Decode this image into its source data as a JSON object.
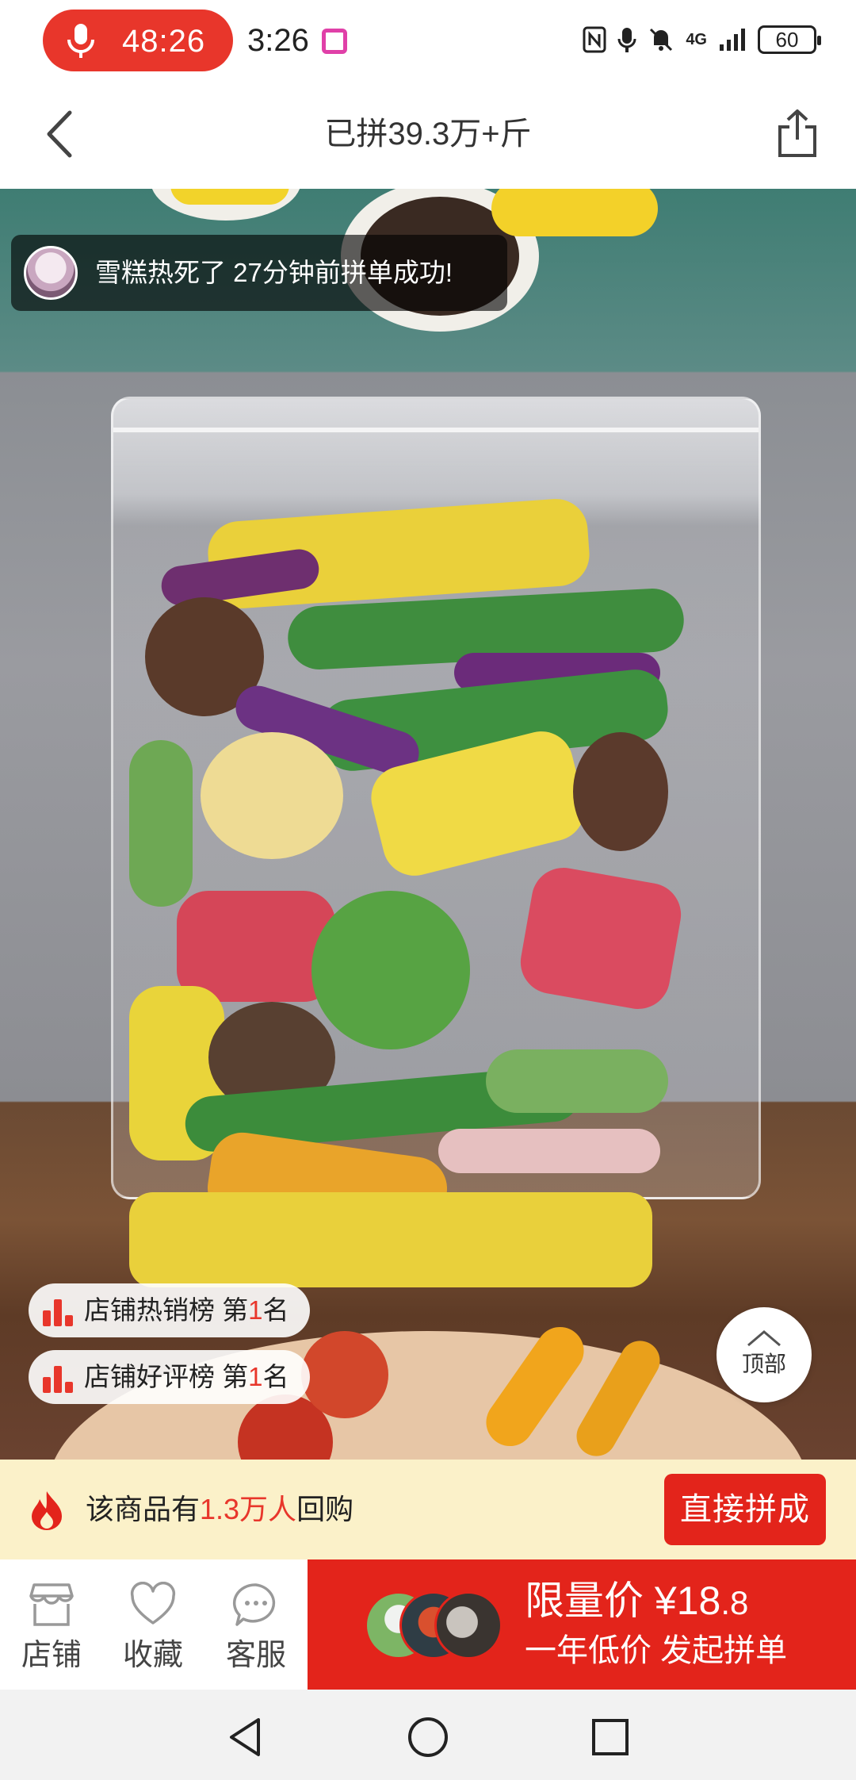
{
  "status_bar": {
    "recording_timer": "48:26",
    "clock": "3:26",
    "network": "4G",
    "battery": "60"
  },
  "nav": {
    "title": "已拼39.3万+斤"
  },
  "toast": {
    "text": "雪糕热死了 27分钟前拼单成功!"
  },
  "rankings": [
    {
      "prefix": "店铺热销榜 第",
      "rank": "1",
      "suffix": "名"
    },
    {
      "prefix": "店铺好评榜 第",
      "rank": "1",
      "suffix": "名"
    }
  ],
  "top_button": {
    "label": "顶部"
  },
  "repurchase": {
    "prefix": "该商品有",
    "highlight": "1.3万人",
    "suffix": "回购",
    "button_label": "直接拼成"
  },
  "bottom_bar": {
    "items": [
      {
        "label": "店铺",
        "icon": "store-icon"
      },
      {
        "label": "收藏",
        "icon": "heart-icon"
      },
      {
        "label": "客服",
        "icon": "chat-bubble-icon"
      }
    ],
    "group_buy": {
      "price_label": "限量价 ¥18",
      "price_decimal": ".8",
      "subtitle": "一年低价 发起拼单"
    }
  },
  "colors": {
    "brand_red": "#e3241b",
    "repurchase_bg": "#fbf1c9"
  }
}
